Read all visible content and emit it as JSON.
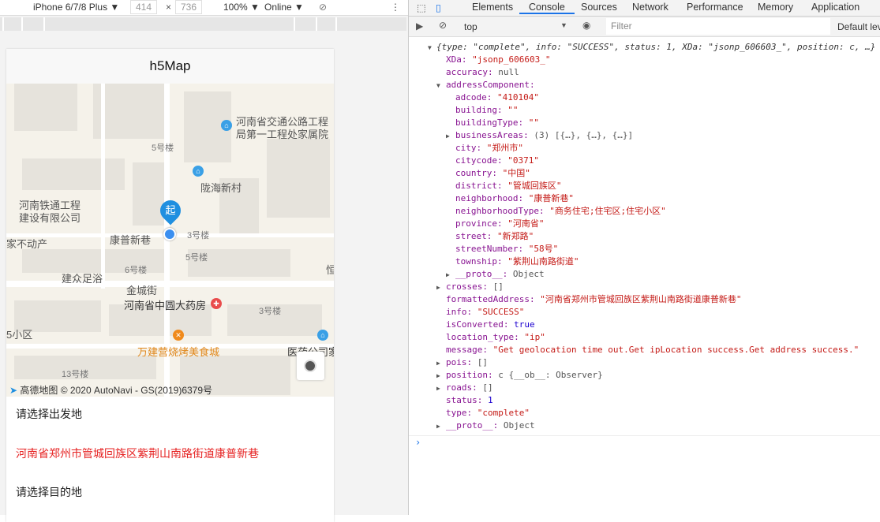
{
  "device_toolbar": {
    "device": "iPhone 6/7/8 Plus ▼",
    "width": "414",
    "times": "×",
    "height": "736",
    "zoom": "100% ▼",
    "network": "Online ▼"
  },
  "page": {
    "title": "h5Map",
    "start_prompt": "请选择出发地",
    "start_address": "河南省郑州市管城回族区紫荆山南路街道康普新巷",
    "dest_prompt": "请选择目的地"
  },
  "map": {
    "labels": [
      "河南省交通公路工程",
      "局第一工程处家属院",
      "5号楼",
      "陇海新村",
      "河南铁通工程",
      "建设有限公司",
      "康普新巷",
      "3号楼",
      "5号楼",
      "家不动产",
      "6号楼",
      "建众足浴",
      "金城街",
      "河南省中圆大药房",
      "3号楼",
      "万建营烧烤美食城",
      "医药公司家",
      "13号楼",
      "5小区",
      "恒"
    ],
    "start_marker": "起",
    "attribution": "高德地图 © 2020 AutoNavi - GS(2019)6379号"
  },
  "devtools": {
    "tabs": [
      "Elements",
      "Console",
      "Sources",
      "Network",
      "Performance",
      "Memory",
      "Application"
    ],
    "active_tab": "Console",
    "context": "top",
    "filter_placeholder": "Filter",
    "levels": "Default levels"
  },
  "console": {
    "summary": [
      [
        "i",
        "{type: "
      ],
      [
        "s",
        "\"complete\""
      ],
      [
        "i",
        ", info: "
      ],
      [
        "s",
        "\"SUCCESS\""
      ],
      [
        "i",
        ", status: "
      ],
      [
        "n",
        "1"
      ],
      [
        "i",
        ", XDa: "
      ],
      [
        "s",
        "\"jsonp_606603_\""
      ],
      [
        "i",
        ", position: c, …}"
      ]
    ],
    "lines": [
      {
        "d": 1,
        "k": "XDa",
        "v": "\"jsonp_606603_\"",
        "t": "s"
      },
      {
        "d": 1,
        "k": "accuracy",
        "v": "null",
        "t": "g"
      },
      {
        "d": 1,
        "k": "addressComponent",
        "v": "",
        "t": "g",
        "exp": "open"
      },
      {
        "d": 2,
        "k": "adcode",
        "v": "\"410104\"",
        "t": "s"
      },
      {
        "d": 2,
        "k": "building",
        "v": "\"\"",
        "t": "s"
      },
      {
        "d": 2,
        "k": "buildingType",
        "v": "\"\"",
        "t": "s"
      },
      {
        "d": 2,
        "k": "businessAreas",
        "v": "(3) [{…}, {…}, {…}]",
        "t": "g",
        "exp": "closed"
      },
      {
        "d": 2,
        "k": "city",
        "v": "\"郑州市\"",
        "t": "s"
      },
      {
        "d": 2,
        "k": "citycode",
        "v": "\"0371\"",
        "t": "s"
      },
      {
        "d": 2,
        "k": "country",
        "v": "\"中国\"",
        "t": "s"
      },
      {
        "d": 2,
        "k": "district",
        "v": "\"管城回族区\"",
        "t": "s"
      },
      {
        "d": 2,
        "k": "neighborhood",
        "v": "\"康普新巷\"",
        "t": "s"
      },
      {
        "d": 2,
        "k": "neighborhoodType",
        "v": "\"商务住宅;住宅区;住宅小区\"",
        "t": "s"
      },
      {
        "d": 2,
        "k": "province",
        "v": "\"河南省\"",
        "t": "s"
      },
      {
        "d": 2,
        "k": "street",
        "v": "\"新郑路\"",
        "t": "s"
      },
      {
        "d": 2,
        "k": "streetNumber",
        "v": "\"58号\"",
        "t": "s"
      },
      {
        "d": 2,
        "k": "township",
        "v": "\"紫荆山南路街道\"",
        "t": "s"
      },
      {
        "d": 2,
        "k": "__proto__",
        "v": "Object",
        "t": "g",
        "exp": "closed"
      },
      {
        "d": 1,
        "k": "crosses",
        "v": "[]",
        "t": "g",
        "exp": "closed"
      },
      {
        "d": 1,
        "k": "formattedAddress",
        "v": "\"河南省郑州市管城回族区紫荆山南路街道康普新巷\"",
        "t": "s"
      },
      {
        "d": 1,
        "k": "info",
        "v": "\"SUCCESS\"",
        "t": "s"
      },
      {
        "d": 1,
        "k": "isConverted",
        "v": "true",
        "t": "n"
      },
      {
        "d": 1,
        "k": "location_type",
        "v": "\"ip\"",
        "t": "s"
      },
      {
        "d": 1,
        "k": "message",
        "v": "\"Get geolocation time out.Get ipLocation success.Get address success.\"",
        "t": "s"
      },
      {
        "d": 1,
        "k": "pois",
        "v": "[]",
        "t": "g",
        "exp": "closed"
      },
      {
        "d": 1,
        "k": "position",
        "v": "c {__ob__: Observer}",
        "t": "g",
        "exp": "closed"
      },
      {
        "d": 1,
        "k": "roads",
        "v": "[]",
        "t": "g",
        "exp": "closed"
      },
      {
        "d": 1,
        "k": "status",
        "v": "1",
        "t": "n"
      },
      {
        "d": 1,
        "k": "type",
        "v": "\"complete\"",
        "t": "s"
      },
      {
        "d": 1,
        "k": "__proto__",
        "v": "Object",
        "t": "g",
        "exp": "closed"
      }
    ],
    "prompt": "›"
  }
}
